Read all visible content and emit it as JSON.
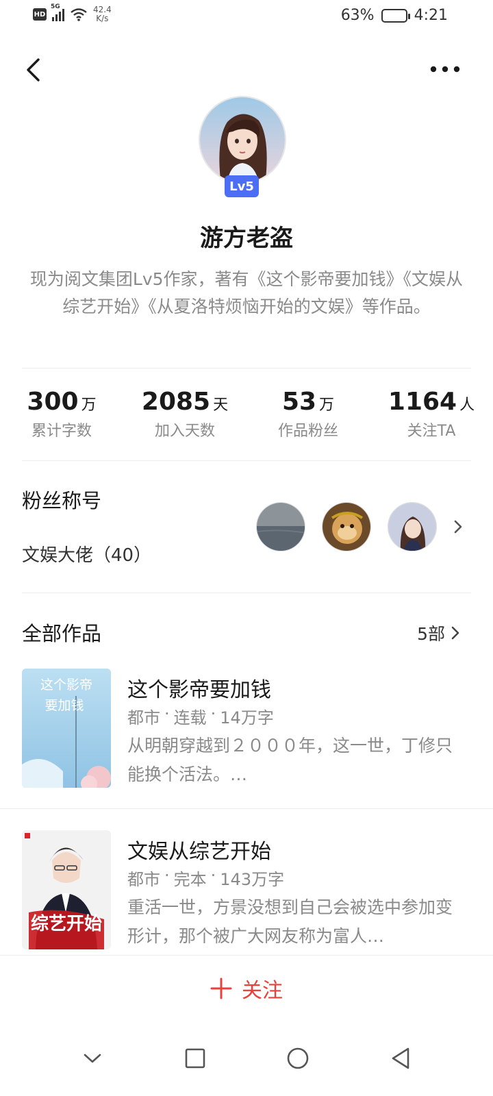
{
  "status_bar": {
    "hd": "HD",
    "signal": "5G",
    "net_speed_value": "42.4",
    "net_speed_unit": "K/s",
    "battery_pct": "63%",
    "battery_level": 0.63,
    "time": "4:21"
  },
  "profile": {
    "level_badge": "Lv5",
    "name": "游方老盗",
    "bio": "现为阅文集团Lv5作家，著有《这个影帝要加钱》《文娱从综艺开始》《从夏洛特烦恼开始的文娱》等作品。"
  },
  "stats": [
    {
      "value": "300",
      "unit": "万",
      "label": "累计字数"
    },
    {
      "value": "2085",
      "unit": "天",
      "label": "加入天数"
    },
    {
      "value": "53",
      "unit": "万",
      "label": "作品粉丝"
    },
    {
      "value": "1164",
      "unit": "人",
      "label": "关注TA"
    }
  ],
  "fans": {
    "section_title": "粉丝称号",
    "fan_title": "文娱大佬（40）"
  },
  "works": {
    "section_title": "全部作品",
    "count": "5部",
    "books": [
      {
        "title": "这个影帝要加钱",
        "genre": "都市",
        "status": "连载",
        "words": "14万字",
        "desc": "从明朝穿越到２０００年，这一世，丁修只能换个活法。…",
        "cover_text": "这个影帝要加钱"
      },
      {
        "title": "文娱从综艺开始",
        "genre": "都市",
        "status": "完本",
        "words": "143万字",
        "desc": "重活一世，方景没想到自己会被选中参加变形计，那个被广大网友称为富人…",
        "cover_text": "文娱从综艺开始"
      }
    ]
  },
  "follow_button": {
    "label": "关注"
  },
  "colors": {
    "accent_red": "#e8413c",
    "badge_blue": "#4c6ef5",
    "muted_text": "#8a8a8a"
  },
  "icons": [
    "back-arrow-icon",
    "more-dots-icon",
    "chevron-right-icon",
    "plus-icon",
    "nav-back-icon",
    "nav-home-icon",
    "nav-recents-icon",
    "nav-collapse-icon"
  ]
}
